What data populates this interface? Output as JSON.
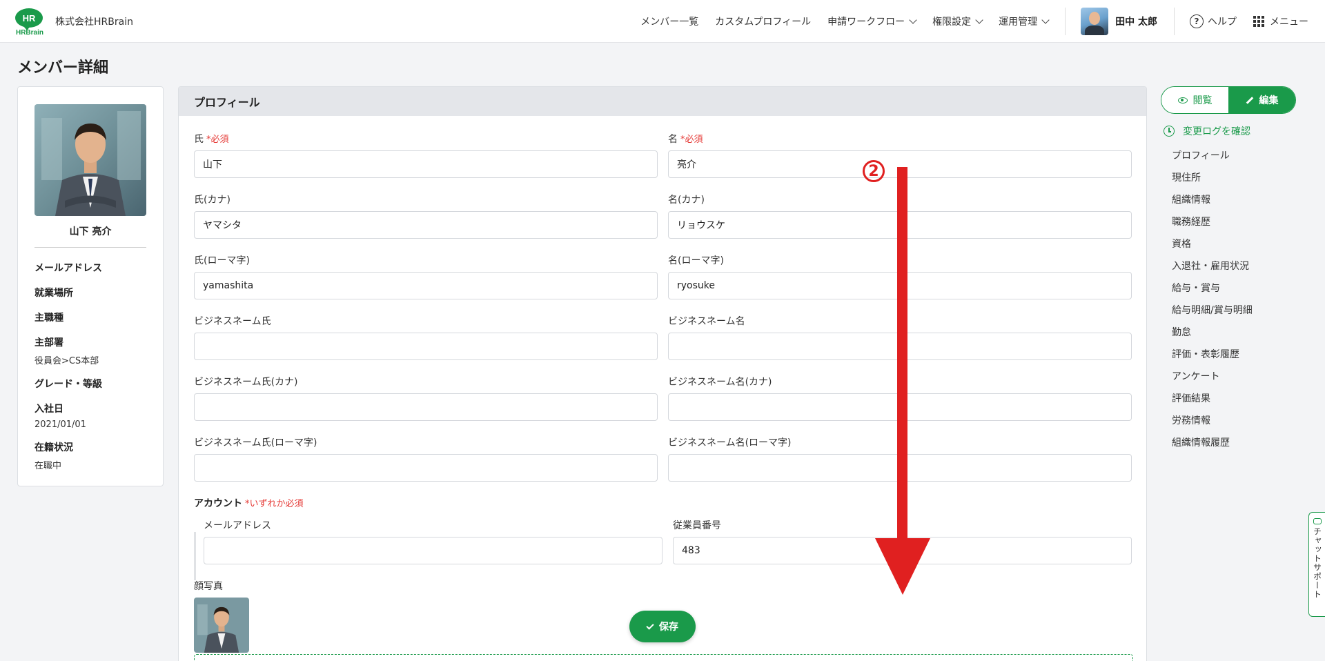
{
  "header": {
    "logo_mark": "HR",
    "logo_text": "HRBrain",
    "company": "株式会社HRBrain",
    "nav": [
      "メンバー一覧",
      "カスタムプロフィール",
      "申請ワークフロー",
      "権限設定",
      "運用管理"
    ],
    "user_name": "田中 太郎",
    "help": "ヘルプ",
    "menu": "メニュー"
  },
  "page_title": "メンバー詳細",
  "member_card": {
    "name": "山下 亮介",
    "info": [
      {
        "label": "メールアドレス",
        "value": ""
      },
      {
        "label": "就業場所",
        "value": ""
      },
      {
        "label": "主職種",
        "value": ""
      },
      {
        "label": "主部署",
        "value": "役員会>CS本部"
      },
      {
        "label": "グレード・等級",
        "value": ""
      },
      {
        "label": "入社日",
        "value": "2021/01/01"
      },
      {
        "label": "在籍状況",
        "value": "在職中"
      }
    ]
  },
  "profile": {
    "section_title": "プロフィール",
    "required_mark": "*必須",
    "fields": {
      "last_name": {
        "label": "氏",
        "value": "山下"
      },
      "first_name": {
        "label": "名",
        "value": "亮介"
      },
      "last_kana": {
        "label": "氏(カナ)",
        "value": "ヤマシタ"
      },
      "first_kana": {
        "label": "名(カナ)",
        "value": "リョウスケ"
      },
      "last_roman": {
        "label": "氏(ローマ字)",
        "value": "yamashita"
      },
      "first_roman": {
        "label": "名(ローマ字)",
        "value": "ryosuke"
      },
      "biz_last": {
        "label": "ビジネスネーム氏",
        "value": ""
      },
      "biz_first": {
        "label": "ビジネスネーム名",
        "value": ""
      },
      "biz_last_kana": {
        "label": "ビジネスネーム氏(カナ)",
        "value": ""
      },
      "biz_first_kana": {
        "label": "ビジネスネーム名(カナ)",
        "value": ""
      },
      "biz_last_roman": {
        "label": "ビジネスネーム氏(ローマ字)",
        "value": ""
      },
      "biz_first_roman": {
        "label": "ビジネスネーム名(ローマ字)",
        "value": ""
      }
    },
    "account": {
      "label": "アカウント",
      "required_mark": "*いずれか必須",
      "email_label": "メールアドレス",
      "email_value": "",
      "employee_label": "従業員番号",
      "employee_value": "483"
    },
    "face_photo_label": "顔写真",
    "save_label": "保存"
  },
  "right_panel": {
    "view_label": "閲覧",
    "edit_label": "編集",
    "changelog_label": "変更ログを確認",
    "toc": [
      "プロフィール",
      "現住所",
      "組織情報",
      "職務経歴",
      "資格",
      "入退社・雇用状況",
      "給与・賞与",
      "給与明細/賞与明細",
      "勤怠",
      "評価・表彰履歴",
      "アンケート",
      "評価結果",
      "労務情報",
      "組織情報履歴"
    ]
  },
  "chat_support": "チャットサポート",
  "annotation": {
    "step": "2",
    "color": "#e02020"
  },
  "colors": {
    "brand": "#1a9a4a",
    "required": "#e53935"
  }
}
